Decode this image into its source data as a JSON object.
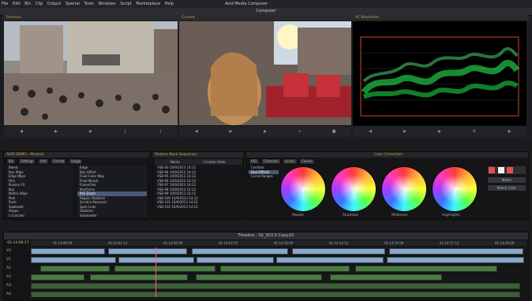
{
  "window": {
    "app_title": "Avid Media Composer",
    "menu": [
      "File",
      "Edit",
      "Bin",
      "Clip",
      "Output",
      "Special",
      "Tools",
      "Windows",
      "Script",
      "Marketplace",
      "Help"
    ],
    "composer_title": "Composer",
    "timeline_title": "Timeline - 02_SC0.5 Copy.01"
  },
  "monitors": {
    "left_label": "Previous",
    "middle_label": "Current",
    "right_label": "YC Waveform"
  },
  "bin": {
    "title": "AVID DEMO - Marked",
    "subtitle": "AVID DEMO - Marked",
    "tabs": [
      "Bin",
      "Settings",
      "Info",
      "Format",
      "Usage"
    ],
    "left_list": [
      "Blend",
      "Box Wipe",
      "Edge Wipe",
      "Film",
      "Illusion FX",
      "Key",
      "Matrix Wipe",
      "Peel",
      "Push",
      "Sawtooth",
      "Shape",
      "L-Conceal",
      "Slide",
      "Spin",
      "Squeeze"
    ],
    "right_list": [
      "Edge",
      "Blur Effect",
      "Fluid Color Map",
      "Fluid Morph",
      "FrameFlex",
      "Keyframe",
      "Pan Zoom",
      "Region Stabilize",
      "Scratch Removal",
      "Spot Color",
      "Stabilize",
      "Submaster"
    ],
    "selected_index": 6
  },
  "sequence": {
    "title": "Restore Back Sequence",
    "columns": [
      "Name",
      "Creation Date"
    ],
    "rows": [
      {
        "name": "VSB-93",
        "date": "10/9/2013 14:12"
      },
      {
        "name": "VSB-94",
        "date": "10/9/2013 14:12"
      },
      {
        "name": "VSB-95",
        "date": "10/9/2013 14:12"
      },
      {
        "name": "VSB-96",
        "date": "10/9/2013 14:12"
      },
      {
        "name": "VSB-97",
        "date": "10/9/2013 14:12"
      },
      {
        "name": "VSB-98",
        "date": "10/9/2013 14:12"
      },
      {
        "name": "VSB-99",
        "date": "10/9/2013 14:12"
      },
      {
        "name": "VSB-100",
        "date": "10/9/2013 14:12"
      },
      {
        "name": "VSB-101",
        "date": "10/9/2013 14:12"
      },
      {
        "name": "VSB-102",
        "date": "10/9/2013 14:12"
      }
    ]
  },
  "color_correction": {
    "title": "Color Correction",
    "mode_tabs": [
      "HSL",
      "Channels",
      "Levels",
      "Curves"
    ],
    "left_items": [
      "Controls",
      "Hue Offsets",
      "Curve Ranges"
    ],
    "wheel_labels": [
      "Master",
      "Shadows",
      "Midtones",
      "Highlights"
    ],
    "right_buttons": [
      "Match",
      "Match Color"
    ]
  },
  "timeline": {
    "timecode": "01:14:00:17",
    "ruler": [
      "01:14:00:00",
      "01:14:02:12",
      "01:14:05:00",
      "01:14:07:12",
      "01:14:10:00",
      "01:14:12:12",
      "01:14:15:00",
      "01:14:17:12",
      "01:14:20:00"
    ],
    "tracks": [
      "V2",
      "V1",
      "A1",
      "A2",
      "A3",
      "A4",
      "A5"
    ]
  }
}
